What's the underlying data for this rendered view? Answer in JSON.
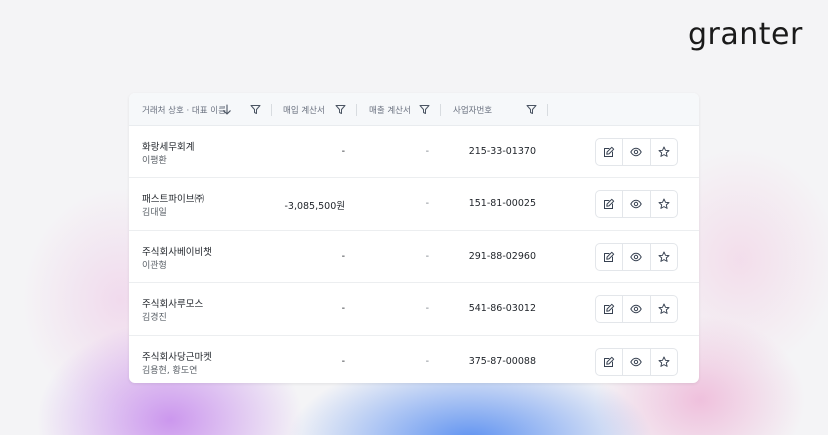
{
  "brand": {
    "logo_text": "granter"
  },
  "table": {
    "headers": {
      "partner": "거래처 상호 · 대표 이름",
      "purchase": "매입 계산서",
      "sales": "매출 계산서",
      "biz_no": "사업자번호"
    },
    "rows": [
      {
        "name": "화랑세무회계",
        "rep": "이평환",
        "purchase": "-",
        "sales": "-",
        "biz_no": "215-33-01370"
      },
      {
        "name": "패스트파이브㈜",
        "rep": "김대일",
        "purchase": "-3,085,500원",
        "sales": "-",
        "biz_no": "151-81-00025"
      },
      {
        "name": "주식회사베이비챗",
        "rep": "이관형",
        "purchase": "-",
        "sales": "-",
        "biz_no": "291-88-02960"
      },
      {
        "name": "주식회사루모스",
        "rep": "김경진",
        "purchase": "-",
        "sales": "-",
        "biz_no": "541-86-03012"
      },
      {
        "name": "주식회사당근마켓",
        "rep": "김용현, 황도연",
        "purchase": "-",
        "sales": "-",
        "biz_no": "375-87-00088"
      }
    ]
  },
  "icons": {
    "sort": "arrow-down-icon",
    "filter": "filter-icon",
    "edit": "pencil-icon",
    "view": "eye-icon",
    "favorite": "star-icon"
  }
}
